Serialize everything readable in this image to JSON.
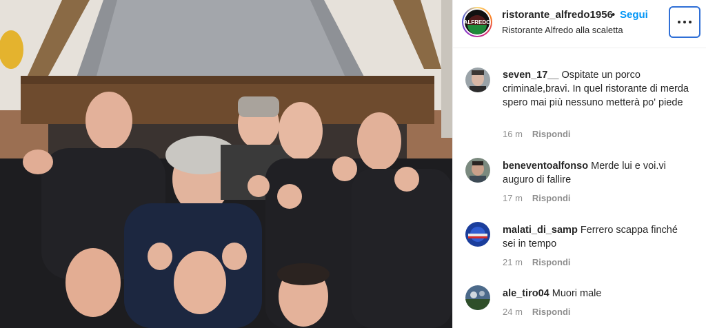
{
  "header": {
    "username": "ristorante_alfredo1956",
    "separator": "•",
    "follow_label": "Segui",
    "location": "Ristorante Alfredo alla scaletta",
    "avatar_logo_text": "ALFREDO"
  },
  "comments": [
    {
      "username": "seven_17__",
      "text": "Ospitate un porco criminale,bravi. In quel ristorante di merda spero mai più nessuno metterà po' piede",
      "time": "16 m",
      "reply_label": "Rispondi"
    },
    {
      "username": "beneventoalfonso",
      "text": "Merde lui e voi.vi auguro di fallire",
      "time": "17 m",
      "reply_label": "Rispondi"
    },
    {
      "username": "malati_di_samp",
      "text": "Ferrero scappa finché sei in tempo",
      "time": "21 m",
      "reply_label": "Rispondi"
    },
    {
      "username": "ale_tiro04",
      "text": "Muori male",
      "time": "24 m",
      "reply_label": "Rispondi"
    }
  ],
  "colors": {
    "follow": "#0095f6",
    "text": "#262626",
    "meta": "#8e8e8e",
    "focus_outline": "#2f6fd6"
  }
}
